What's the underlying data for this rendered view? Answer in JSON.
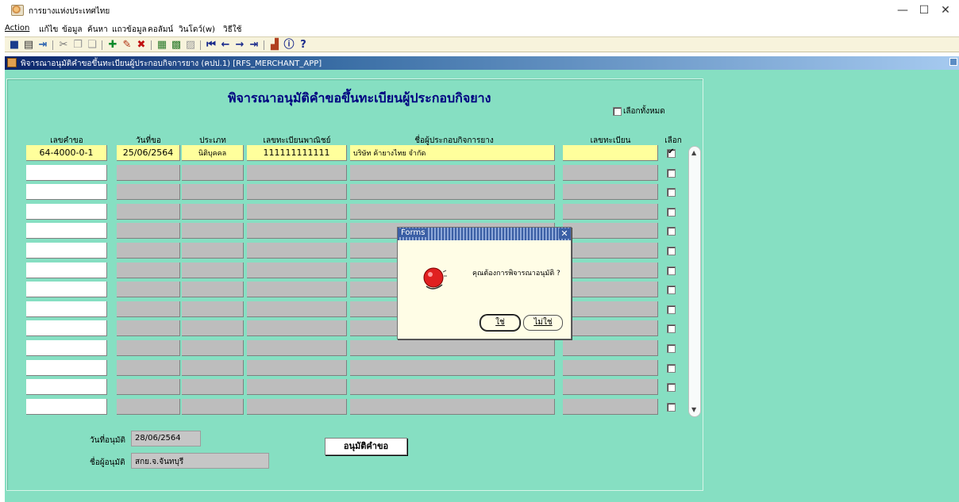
{
  "window": {
    "title": "การยางแห่งประเทศไทย",
    "minimize": "—",
    "maximize": "☐",
    "close": "✕"
  },
  "menu": [
    "Action",
    "แก้ไข",
    "ข้อมูล",
    "ค้นหา",
    "แถวข้อมูล",
    "คอลัมน์",
    "วินโดว์(w)",
    "วิธีใช้"
  ],
  "toolbar": {
    "icons": [
      "save-icon",
      "print-icon",
      "exit-icon",
      "cut-icon",
      "copy-icon",
      "paste-icon",
      "insert-record-icon",
      "edit-icon",
      "delete-record-icon",
      "query-icon",
      "execute-query-icon",
      "cancel-query-icon",
      "first-record-icon",
      "previous-record-icon",
      "next-record-icon",
      "last-record-icon",
      "chart-icon",
      "info-icon",
      "help-icon"
    ]
  },
  "form": {
    "window_title": "พิจารณาอนุมัติคำขอขึ้นทะเบียนผู้ประกอบกิจการยาง (คปป.1) [RFS_MERCHANT_APP]",
    "heading": "พิจารณาอนุมัติคำขอขึ้นทะเบียนผู้ประกอบกิจยาง",
    "select_all_label": "เลือกทั้งหมด",
    "columns": [
      "เลขคำขอ",
      "วันที่ขอ",
      "ประเภท",
      "เลขทะเบียนพาณิชย์",
      "ชื่อผู้ประกอบกิจการยาง",
      "เลขทะเบียน",
      "เลือก"
    ],
    "rows": [
      {
        "req_no": "64-4000-0-1",
        "req_date": "25/06/2564",
        "type": "นิติบุคคล",
        "commerce_reg": "111111111111",
        "name": "บริษัท ค้ายางไทย จำกัด",
        "reg_no": "",
        "selected": true
      }
    ],
    "empty_rows": 13,
    "approve_date_label": "วันที่อนุมัติ",
    "approve_date": "28/06/2564",
    "approver_label": "ชื่อผู้อนุมัติ",
    "approver": "สกย.จ.จันทบุรี",
    "approve_button": "อนุมัติคำขอ"
  },
  "dialog": {
    "title": "Forms",
    "message": "คุณต้องการพิจารณาอนุมัติ ?",
    "yes": "ใช่",
    "no": "ไม่ใช่",
    "icon": "alert-bell-icon"
  },
  "colors": {
    "canvas": "#86dfc2",
    "highlight": "#ffff9c",
    "disabled": "#bdbdbd",
    "title_blue": "#000080"
  }
}
